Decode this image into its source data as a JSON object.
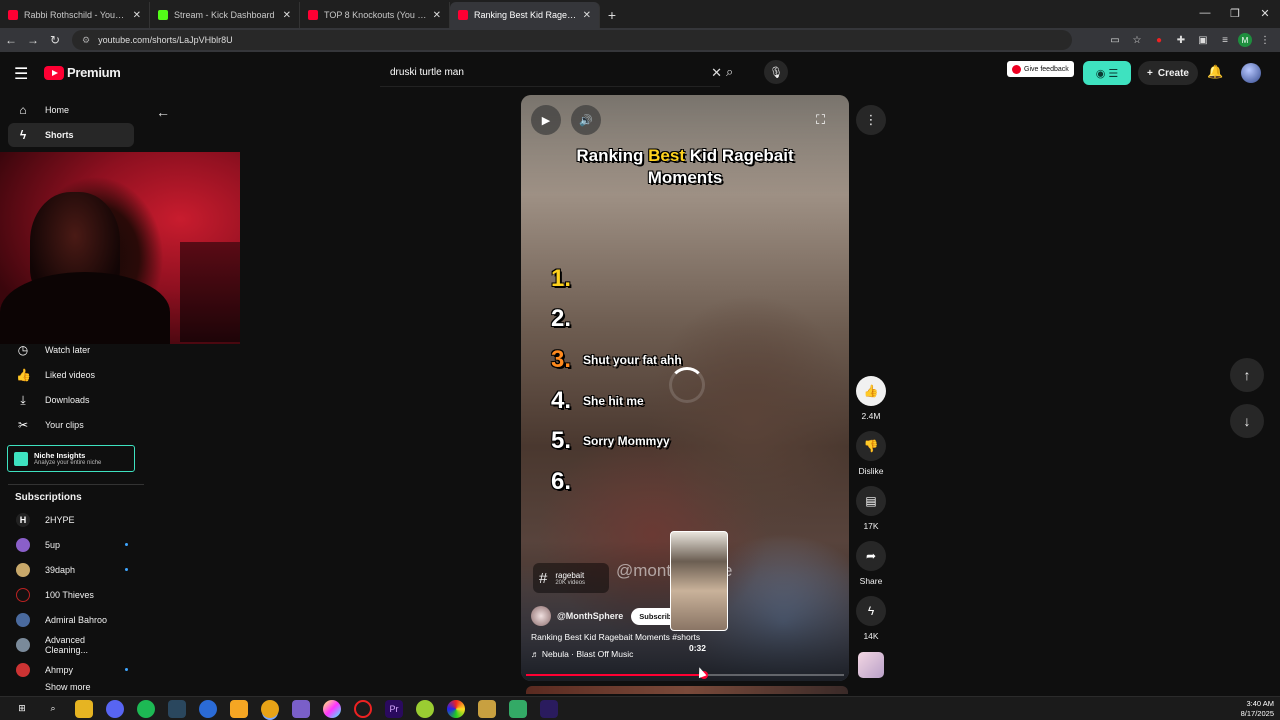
{
  "browser": {
    "tabs": [
      {
        "label": "Rabbi Rothschild - YouTube",
        "favicon": "youtube-icon"
      },
      {
        "label": "Stream - Kick Dashboard",
        "favicon": "kick-icon"
      },
      {
        "label": "TOP 8 Knockouts (You Havent s",
        "favicon": "youtube-icon"
      },
      {
        "label": "Ranking Best Kid Ragebait Mo",
        "favicon": "youtube-icon"
      }
    ],
    "url": "youtube.com/shorts/LaJpVHblr8U",
    "avatar_letter": "M"
  },
  "header": {
    "brand": "Premium",
    "search_value": "druski turtle man",
    "feedback_label": "Give feedback",
    "create_label": "Create"
  },
  "sidebar": {
    "items": [
      {
        "label": "Home",
        "icon": "home-icon"
      },
      {
        "label": "Shorts",
        "icon": "shorts-icon"
      },
      {
        "label": "Watch later",
        "icon": "clock-icon"
      },
      {
        "label": "Liked videos",
        "icon": "thumbs-up-icon"
      },
      {
        "label": "Downloads",
        "icon": "download-icon"
      },
      {
        "label": "Your clips",
        "icon": "scissors-icon"
      }
    ],
    "niche": {
      "title": "Niche Insights",
      "subtitle": "Analyze your entire niche"
    },
    "subscriptions_title": "Subscriptions",
    "subscriptions": [
      {
        "name": "2HYPE",
        "new": false
      },
      {
        "name": "5up",
        "new": true
      },
      {
        "name": "39daph",
        "new": true
      },
      {
        "name": "100 Thieves",
        "new": false
      },
      {
        "name": "Admiral Bahroo",
        "new": false
      },
      {
        "name": "Advanced Cleaning...",
        "new": false
      },
      {
        "name": "Ahmpy",
        "new": true
      }
    ],
    "show_more": "Show more"
  },
  "video": {
    "title_part1": "Ranking ",
    "title_highlight": "Best",
    "title_part2": " Kid Ragebait",
    "title_line2": "Moments",
    "ranks": [
      {
        "num": "1.",
        "label": ""
      },
      {
        "num": "2.",
        "label": ""
      },
      {
        "num": "3.",
        "label": "Shut your fat ahh"
      },
      {
        "num": "4.",
        "label": "She hit me"
      },
      {
        "num": "5.",
        "label": "Sorry Mommyy"
      },
      {
        "num": "6.",
        "label": ""
      }
    ],
    "watermark": "@monthsphere",
    "hashtag": {
      "tag": "ragebait",
      "count": "20K videos"
    },
    "channel": "@MonthSphere",
    "subscribe_label": "Subscribe",
    "caption": "Ranking Best Kid Ragebait Moments #shorts",
    "music": "Nebula · Blast Off Music",
    "preview_time": "0:32",
    "progress": 0.56
  },
  "actions": {
    "likes": "2.4M",
    "dislike": "Dislike",
    "comments": "17K",
    "share": "Share",
    "remix": "14K"
  },
  "clock": {
    "time": "3:40 AM",
    "date": "8/17/2025"
  },
  "colors": {
    "accent": "#ff0033",
    "highlight": "#ffd21e",
    "ext": "#3ee2c0"
  }
}
